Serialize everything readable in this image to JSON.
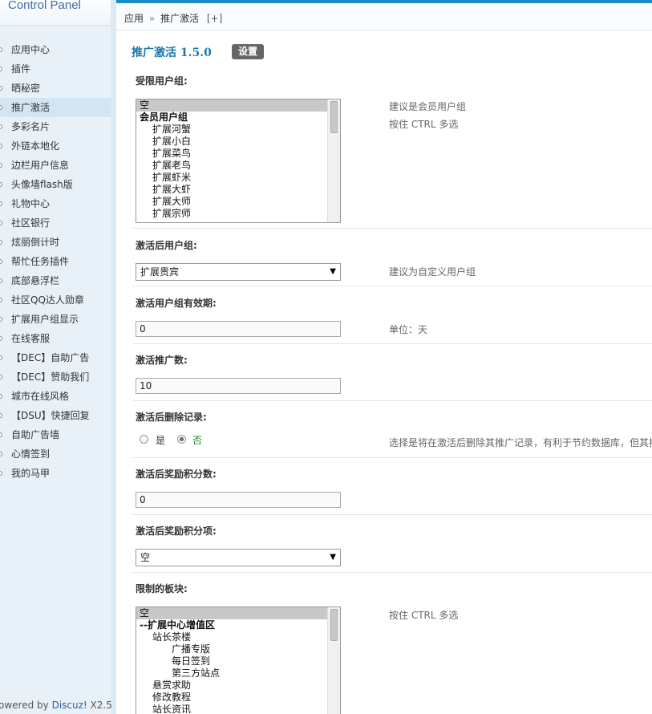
{
  "sidebar": {
    "brand": "Control Panel",
    "items": [
      {
        "label": "应用中心"
      },
      {
        "label": "插件"
      },
      {
        "label": "晒秘密"
      },
      {
        "label": "推广激活"
      },
      {
        "label": "多彩名片"
      },
      {
        "label": "外链本地化"
      },
      {
        "label": "边栏用户信息"
      },
      {
        "label": "头像墙flash版"
      },
      {
        "label": "礼物中心"
      },
      {
        "label": "社区银行"
      },
      {
        "label": "炫丽倒计时"
      },
      {
        "label": "帮忙任务插件"
      },
      {
        "label": "底部悬浮栏"
      },
      {
        "label": "社区QQ达人勋章"
      },
      {
        "label": "扩展用户组显示"
      },
      {
        "label": "在线客服"
      },
      {
        "label": "【DEC】自助广告"
      },
      {
        "label": "【DEC】赞助我们"
      },
      {
        "label": "城市在线风格"
      },
      {
        "label": "【DSU】快捷回复"
      },
      {
        "label": "自助广告墙"
      },
      {
        "label": "心情签到"
      },
      {
        "label": "我的马甲"
      }
    ],
    "active_index": 3,
    "powered_prefix": "owered by",
    "powered_brand": "Discuz!",
    "powered_version": "X2.5"
  },
  "breadcrumb": {
    "root": "应用",
    "sep": "»",
    "current": "推广激活",
    "add": "[+]"
  },
  "page": {
    "title": "推广激活 1.5.0",
    "settings_button": "设置"
  },
  "fields": {
    "restricted_groups": {
      "label": "受限用户组:",
      "options": [
        {
          "text": "空",
          "style": "sel"
        },
        {
          "text": "会员用户组",
          "style": "grp"
        },
        {
          "text": "扩展河蟹",
          "indent": 1
        },
        {
          "text": "扩展小白",
          "indent": 1
        },
        {
          "text": "扩展菜鸟",
          "indent": 1
        },
        {
          "text": "扩展老鸟",
          "indent": 1
        },
        {
          "text": "扩展虾米",
          "indent": 1
        },
        {
          "text": "扩展大虾",
          "indent": 1
        },
        {
          "text": "扩展大师",
          "indent": 1
        },
        {
          "text": "扩展宗师",
          "indent": 1
        }
      ],
      "hint1": "建议是会员用户组",
      "hint2": "按住 CTRL 多选"
    },
    "activated_group": {
      "label": "激活后用户组:",
      "value": "扩展贵宾",
      "hint": "建议为自定义用户组"
    },
    "group_validity": {
      "label": "激活用户组有效期:",
      "value": "0",
      "hint": "单位：天"
    },
    "promo_count": {
      "label": "激活推广数:",
      "value": "10"
    },
    "delete_records": {
      "label": "激活后删除记录:",
      "yes": "是",
      "no": "否",
      "selected": "no",
      "hint": "选择是将在激活后删除其推广记录，有利于节约数据库，但其推"
    },
    "reward_points": {
      "label": "激活后奖励积分数:",
      "value": "0"
    },
    "reward_type": {
      "label": "激活后奖励积分项:",
      "value": "空"
    },
    "limited_boards": {
      "label": "限制的板块:",
      "options": [
        {
          "text": "空",
          "style": "sel"
        },
        {
          "text": "--扩展中心增值区",
          "style": "grp"
        },
        {
          "text": "站长茶楼",
          "indent": 1
        },
        {
          "text": "广播专版",
          "indent": 2
        },
        {
          "text": "每日签到",
          "indent": 2
        },
        {
          "text": "第三方站点",
          "indent": 2
        },
        {
          "text": "悬赏求助",
          "indent": 1
        },
        {
          "text": "修改教程",
          "indent": 1
        },
        {
          "text": "站长资讯",
          "indent": 1
        }
      ],
      "hint": "按住 CTRL 多选"
    }
  }
}
